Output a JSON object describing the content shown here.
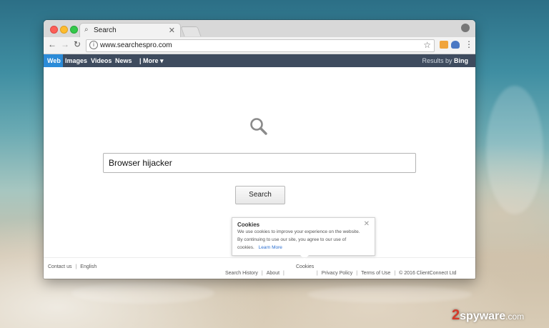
{
  "tab": {
    "title": "Search"
  },
  "address_bar": {
    "url": "www.searchespro.com"
  },
  "nav": {
    "web": "Web",
    "images": "Images",
    "videos": "Videos",
    "news": "News",
    "more": "| More ▾",
    "results_by_prefix": "Results by",
    "results_by_brand": "Bing"
  },
  "search": {
    "query": "Browser hijacker",
    "button_label": "Search"
  },
  "cookie_notice": {
    "title": "Cookies",
    "line1": "We use cookies to improve your experience on the website.",
    "line2": "By continuing to use our site, you agree to our use of",
    "line3_prefix": "cookies.",
    "learn_more": "Learn More"
  },
  "footer": {
    "contact": "Contact us",
    "language": "English",
    "cookies": "Cookies",
    "search_history": "Search History",
    "about": "About",
    "privacy": "Privacy Policy",
    "terms": "Terms of Use",
    "copyright": "© 2016 ClientConnect Ltd"
  },
  "watermark": {
    "num": "2",
    "brand": "spyware",
    "suffix": ".com"
  }
}
